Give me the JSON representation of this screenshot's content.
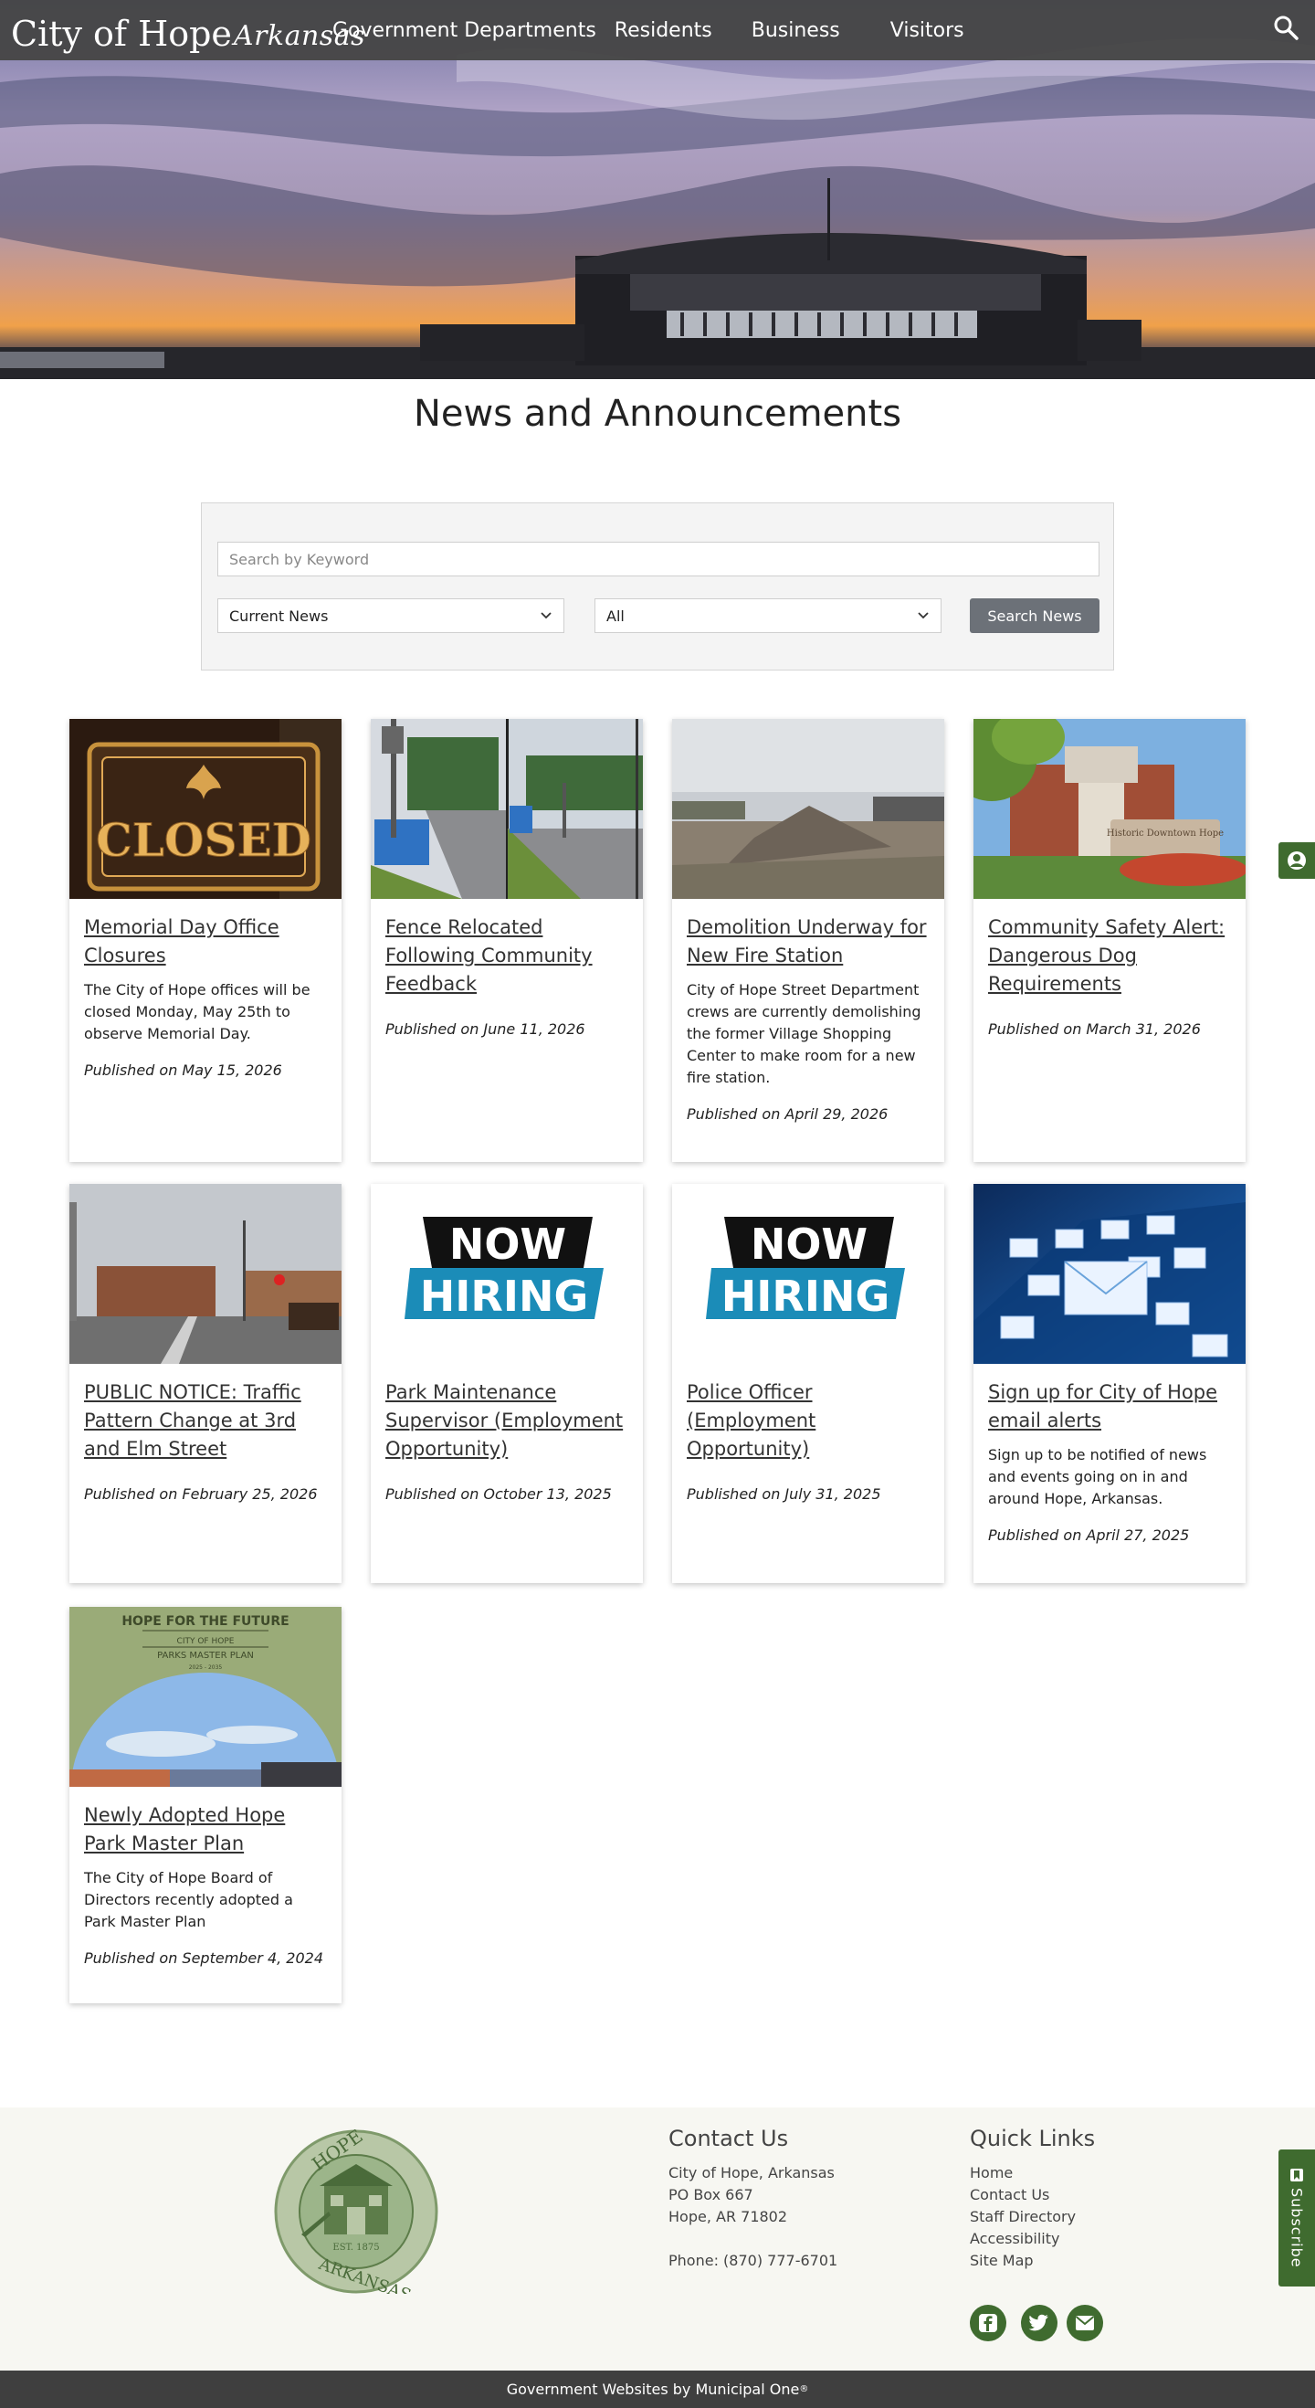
{
  "site": {
    "logo_main": "City of Hope",
    "logo_sub": "Arkansas"
  },
  "nav": {
    "items": [
      "Government Departments",
      "Residents",
      "Business",
      "Visitors"
    ]
  },
  "page": {
    "title": "News and Announcements"
  },
  "search": {
    "placeholder": "Search by Keyword",
    "news_filter": "Current News",
    "category_filter": "All",
    "button_label": "Search News"
  },
  "cards": [
    {
      "title": "Memorial Day Office Closures",
      "desc": "The City of Hope offices will be closed Monday, May 25th to observe Memorial Day.",
      "published": "Published on May 15, 2026"
    },
    {
      "title": "Fence Relocated Following Community Feedback",
      "desc": "",
      "published": "Published on June 11, 2026"
    },
    {
      "title": "Demolition Underway for New Fire Station",
      "desc": "City of Hope Street Department crews are currently demolishing the former Village Shopping Center to make room for a new fire station.",
      "published": "Published on April 29, 2026"
    },
    {
      "title": "Community Safety Alert: Dangerous Dog Requirements",
      "desc": "",
      "published": "Published on March 31, 2026"
    },
    {
      "title": "PUBLIC NOTICE: Traffic Pattern Change at 3rd and Elm Street",
      "desc": "",
      "published": "Published on February 25, 2026"
    },
    {
      "title": "Park Maintenance Supervisor (Employment Opportunity)",
      "desc": "",
      "published": "Published on October 13, 2025"
    },
    {
      "title": "Police Officer (Employment Opportunity)",
      "desc": "",
      "published": "Published on July 31, 2025"
    },
    {
      "title": "Sign up for City of Hope email alerts",
      "desc": "Sign up to be notified of news and events going on in and around Hope, Arkansas.",
      "published": "Published on April 27, 2025"
    },
    {
      "title": "Newly Adopted Hope Park Master Plan",
      "desc": "The City of Hope Board of Directors recently adopted a Park Master Plan",
      "published": "Published on September 4, 2024"
    }
  ],
  "images": {
    "closed_sign": "CLOSED",
    "now": "NOW",
    "hiring": "HIRING",
    "plan_title": "HOPE FOR THE FUTURE",
    "plan_city": "CITY OF HOPE",
    "plan_sub": "PARKS MASTER PLAN",
    "plan_years": "2025 - 2035",
    "dt_sign": "Historic Downtown Hope"
  },
  "seal": {
    "top": "HOPE",
    "bottom": "ARKANSAS",
    "est": "EST. 1875"
  },
  "footer": {
    "contact_heading": "Contact Us",
    "contact_lines": [
      "City of Hope, Arkansas",
      "PO Box 667",
      "Hope, AR 71802"
    ],
    "phone": "Phone: (870) 777-6701",
    "links_heading": "Quick Links",
    "links": [
      "Home",
      "Contact Us",
      "Staff Directory",
      "Accessibility",
      "Site Map"
    ],
    "credit": "Government Websites by Municipal One",
    "credit_mark": "®"
  },
  "subscribe": {
    "label": "Subscribe"
  },
  "colors": {
    "brand_green": "#3f6b2f",
    "header_gray": "#464646",
    "button_gray": "#6c7178"
  }
}
